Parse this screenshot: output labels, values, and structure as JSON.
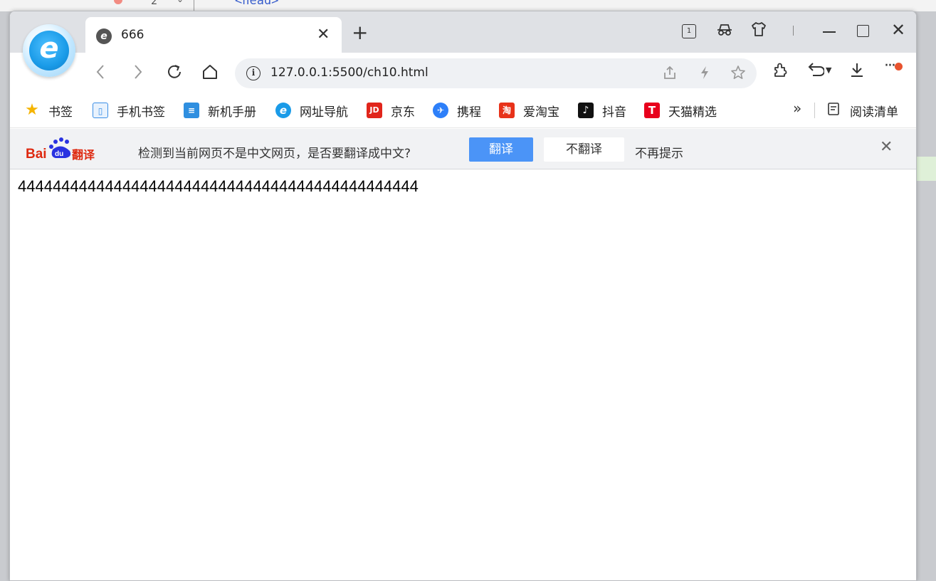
{
  "backdrop": {
    "line_number": "2",
    "code": "<head>"
  },
  "tab": {
    "title": "666",
    "favicon": "e"
  },
  "window_controls": {
    "tab_count": "1"
  },
  "address_bar": {
    "url": "127.0.0.1:5500/ch10.html"
  },
  "bookmarks": [
    {
      "label": "书签",
      "icon": "star-icon",
      "color": "#f5b400",
      "glyph": "★"
    },
    {
      "label": "手机书签",
      "icon": "phone-icon",
      "color": "#3a8ee6",
      "glyph": "▯"
    },
    {
      "label": "新机手册",
      "icon": "manual-icon",
      "color": "#2f8fe0",
      "glyph": "≡"
    },
    {
      "label": "网址导航",
      "icon": "browser-e-icon",
      "color": "#1a9be8",
      "glyph": "e"
    },
    {
      "label": "京东",
      "icon": "jd-icon",
      "color": "#e1251b",
      "glyph": "JD"
    },
    {
      "label": "携程",
      "icon": "ctrip-icon",
      "color": "#2d7ff9",
      "glyph": "✈"
    },
    {
      "label": "爱淘宝",
      "icon": "taobao-icon",
      "color": "#e8321a",
      "glyph": "淘"
    },
    {
      "label": "抖音",
      "icon": "douyin-icon",
      "color": "#111111",
      "glyph": "♪"
    },
    {
      "label": "天猫精选",
      "icon": "tmall-icon",
      "color": "#e8001c",
      "glyph": "T"
    }
  ],
  "reading_list": {
    "label": "阅读清单"
  },
  "translate": {
    "message": "检测到当前网页不是中文网页，是否要翻译成中文?",
    "translate_label": "翻译",
    "no_translate_label": "不翻译",
    "never_label": "不再提示",
    "brand": "Baidu翻译"
  },
  "page": {
    "text": "4444444444444444444444444444444444444444444444"
  }
}
